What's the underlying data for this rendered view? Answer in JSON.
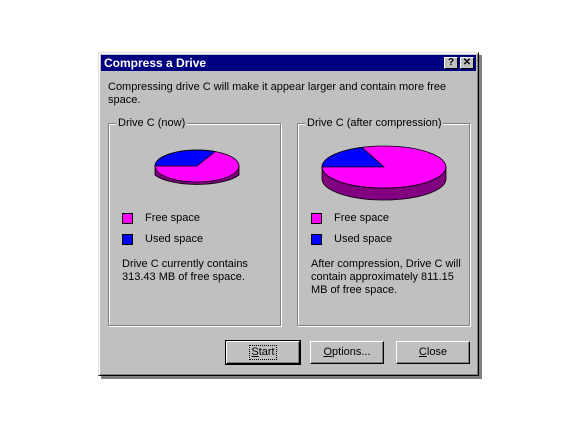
{
  "window": {
    "title": "Compress a Drive",
    "help_button": "?",
    "close_button": "✕"
  },
  "description": "Compressing drive C will make it appear larger and contain more free space.",
  "now_panel": {
    "title": "Drive C (now)",
    "legend": {
      "free": "Free space",
      "used": "Used space"
    },
    "info": "Drive C currently contains 313.43 MB of free space.",
    "free_mb": 313.43
  },
  "after_panel": {
    "title": "Drive C (after compression)",
    "legend": {
      "free": "Free space",
      "used": "Used space"
    },
    "info": "After compression, Drive C will contain approximately 811.15 MB of free space.",
    "free_mb": 811.15
  },
  "colors": {
    "free": "#ff00ff",
    "used": "#0000ff",
    "title_bar": "#000080",
    "face": "#c0c0c0"
  },
  "buttons": {
    "start": {
      "label": "Start",
      "mnemonic": "S",
      "rest": "tart"
    },
    "options": {
      "label": "Options...",
      "mnemonic": "O",
      "rest": "ptions..."
    },
    "close": {
      "label": "Close",
      "mnemonic": "C",
      "rest": "lose"
    }
  }
}
